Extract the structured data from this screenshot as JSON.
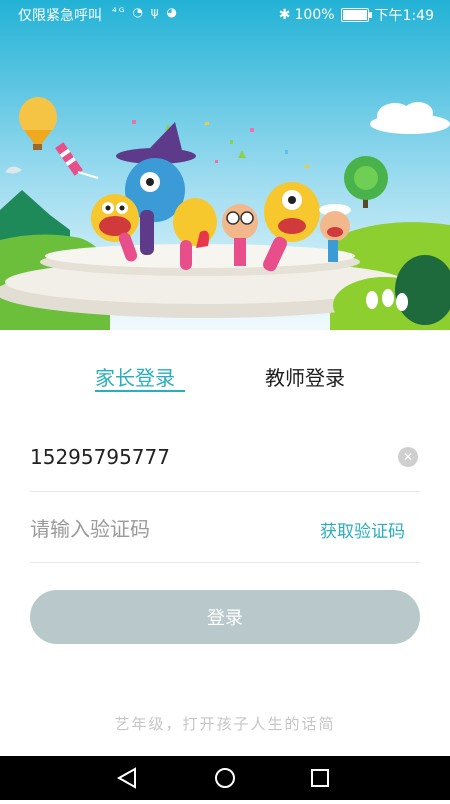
{
  "status_bar": {
    "left_text": "仅限紧急呼叫",
    "icons": "⁴ᴳ ◔ ψ ◕",
    "battery_text": "100%",
    "time": "下午1:49"
  },
  "tabs": {
    "parent_label": "家长登录",
    "teacher_label": "教师登录",
    "active": "parent"
  },
  "form": {
    "phone_value": "15295795777",
    "code_placeholder": "请输入验证码",
    "get_code_label": "获取验证码",
    "clear_icon": "clear-icon",
    "login_label": "登录"
  },
  "footer": {
    "slogan": "艺年级，打开孩子人生的话简"
  },
  "colors": {
    "accent": "#2aaebe",
    "button_disabled": "#b9c8ca",
    "sky_top": "#29b7d7",
    "sky_bottom": "#dff5fb",
    "grass": "#8ccf2f"
  }
}
